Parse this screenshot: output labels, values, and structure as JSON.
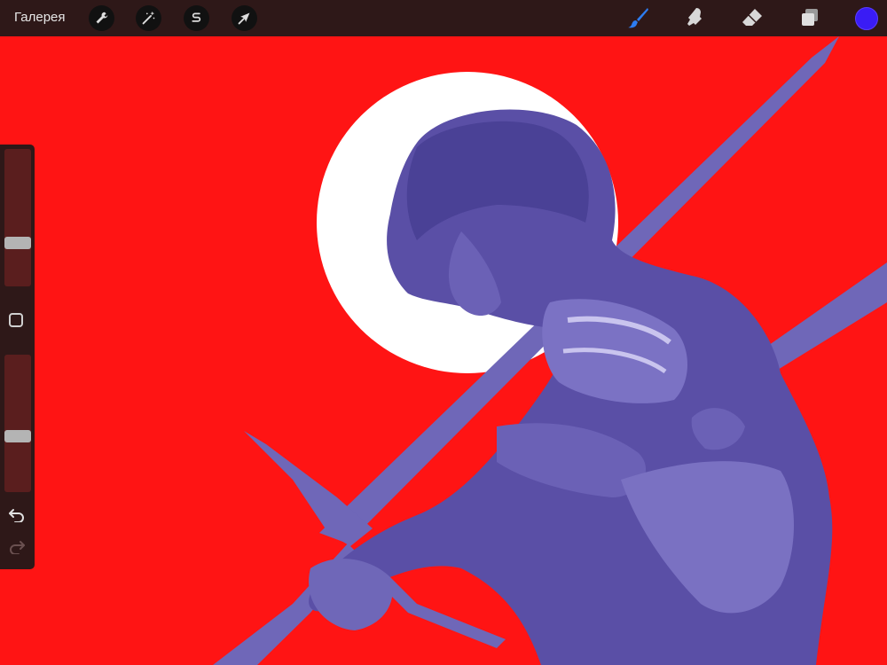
{
  "topbar": {
    "gallery_label": "Галерея",
    "left_tools": [
      {
        "icon": "wrench-icon",
        "name": "actions"
      },
      {
        "icon": "magic-wand-icon",
        "name": "adjustments"
      },
      {
        "icon": "selection-s-icon",
        "name": "selection"
      },
      {
        "icon": "arrow-cursor-icon",
        "name": "transform"
      }
    ],
    "right_tools": [
      {
        "icon": "brush-icon",
        "name": "paint",
        "active": true
      },
      {
        "icon": "smudge-icon",
        "name": "smudge"
      },
      {
        "icon": "eraser-icon",
        "name": "erase"
      },
      {
        "icon": "layers-icon",
        "name": "layers"
      }
    ],
    "current_color": "#3a1cf5"
  },
  "sidebar": {
    "brush_size": 0.3,
    "brush_opacity": 0.4,
    "undo_icon": "undo-icon",
    "redo_icon": "redo-icon"
  },
  "canvas": {
    "background_color": "#ff1414",
    "moon_color": "#ffffff",
    "figure_color": "#5a4fa6"
  }
}
